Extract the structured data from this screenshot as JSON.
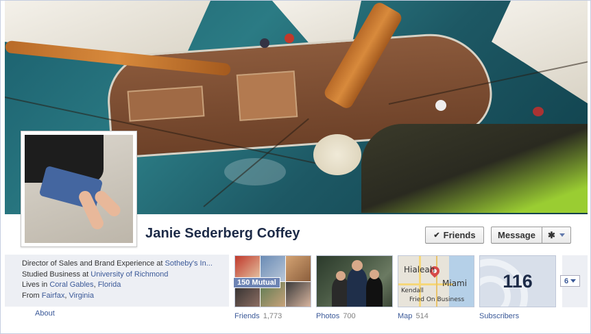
{
  "profile": {
    "name": "Janie Sederberg Coffey"
  },
  "actions": {
    "friends_label": "Friends",
    "message_label": "Message"
  },
  "info": {
    "work_prefix": "Director of Sales and Brand Experience at ",
    "work_link": "Sotheby's In...",
    "study_prefix": "Studied Business at ",
    "study_link": "University of Richmond",
    "lives_prefix": "Lives in ",
    "lives_city": "Coral Gables",
    "lives_sep": ", ",
    "lives_state": "Florida",
    "from_prefix": "From ",
    "from_city": "Fairfax",
    "from_sep": ", ",
    "from_state": "Virginia",
    "about_label": "About"
  },
  "apps": {
    "friends": {
      "label": "Friends",
      "count": "1,773",
      "mutual": "150 Mutual"
    },
    "photos": {
      "label": "Photos",
      "count": "700"
    },
    "map": {
      "label": "Map",
      "count": "514",
      "place_top": "Hialeah",
      "place_mid": "Miami",
      "place_low": "Kendall",
      "caption": "Fried On Business"
    },
    "subscribers": {
      "label": "Subscribers",
      "count": "116"
    },
    "more": {
      "count": "6"
    }
  },
  "icons": {
    "friends_check": "check-icon",
    "gear": "gear-icon",
    "work": "briefcase-icon",
    "study": "graduation-icon",
    "lives": "house-icon",
    "from": "home-icon"
  },
  "colors": {
    "link": "#3b5998",
    "name": "#1c2a47",
    "info_bg": "#edeff4",
    "mutual_badge": "#6d84b4"
  }
}
